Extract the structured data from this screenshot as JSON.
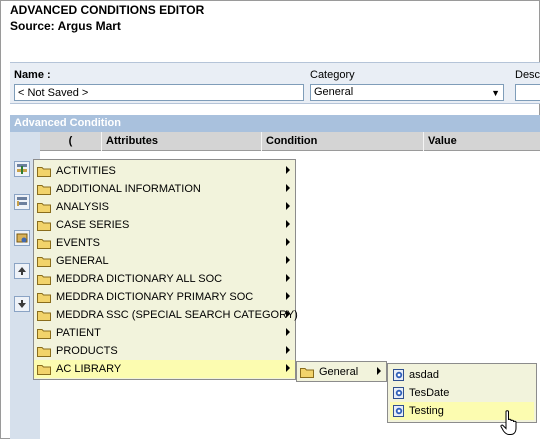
{
  "header": {
    "title": "ADVANCED CONDITIONS EDITOR",
    "source": "Source: Argus Mart"
  },
  "form": {
    "name_label": "Name :",
    "name_value": "< Not Saved >",
    "category_label": "Category",
    "category_value": "General",
    "description_label": "Desc"
  },
  "advanced_condition": {
    "header": "Advanced Condition",
    "columns": [
      "(",
      "Attributes",
      "Condition",
      "Value"
    ]
  },
  "menu": {
    "items": [
      "ACTIVITIES",
      "ADDITIONAL INFORMATION",
      "ANALYSIS",
      "CASE SERIES",
      "EVENTS",
      "GENERAL",
      "MEDDRA DICTIONARY ALL SOC",
      "MEDDRA DICTIONARY PRIMARY SOC",
      "MEDDRA SSC (SPECIAL SEARCH CATEGORY)",
      "PATIENT",
      "PRODUCTS",
      "AC LIBRARY"
    ],
    "highlighted": "AC LIBRARY",
    "submenu": {
      "label": "General"
    },
    "leaf_items": [
      "asdad",
      "TesDate",
      "Testing"
    ],
    "leaf_highlighted": "Testing"
  },
  "colors": {
    "panel_header": "#a9c1dd",
    "menu_bg": "#f2f3dc",
    "menu_highlight": "#fcfcb0"
  },
  "icons": [
    "folder-icon",
    "condition-doc-icon",
    "submenu-arrow-icon",
    "hand-pointer-cursor"
  ]
}
